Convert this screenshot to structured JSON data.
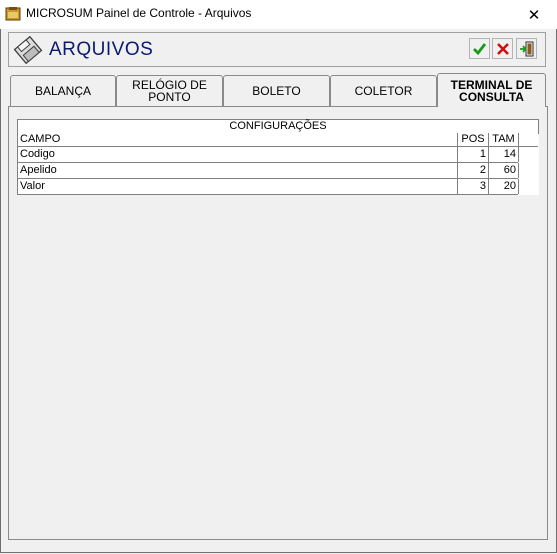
{
  "window": {
    "title": "MICROSUM Painel de Controle - Arquivos",
    "close_label": "✕"
  },
  "header": {
    "title": "ARQUIVOS",
    "icon": "floppy-disk-icon",
    "confirm_icon": "check-icon",
    "cancel_icon": "x-icon",
    "exit_icon": "exit-door-icon"
  },
  "tabs": [
    {
      "label": "BALANÇA"
    },
    {
      "label": "RELÓGIO DE PONTO"
    },
    {
      "label": "BOLETO"
    },
    {
      "label": "COLETOR"
    },
    {
      "label": "TERMINAL DE CONSULTA",
      "active": true
    }
  ],
  "grid": {
    "group_header": "CONFIGURAÇÕES",
    "columns": [
      "CAMPO",
      "POS",
      "TAM"
    ],
    "rows": [
      {
        "campo": "Codigo",
        "pos": "1",
        "tam": "14"
      },
      {
        "campo": "Apelido",
        "pos": "2",
        "tam": "60"
      },
      {
        "campo": "Valor",
        "pos": "3",
        "tam": "20"
      }
    ]
  },
  "colors": {
    "header_title": "#0a1a70",
    "confirm": "#1a9a1a",
    "cancel": "#d01010"
  }
}
